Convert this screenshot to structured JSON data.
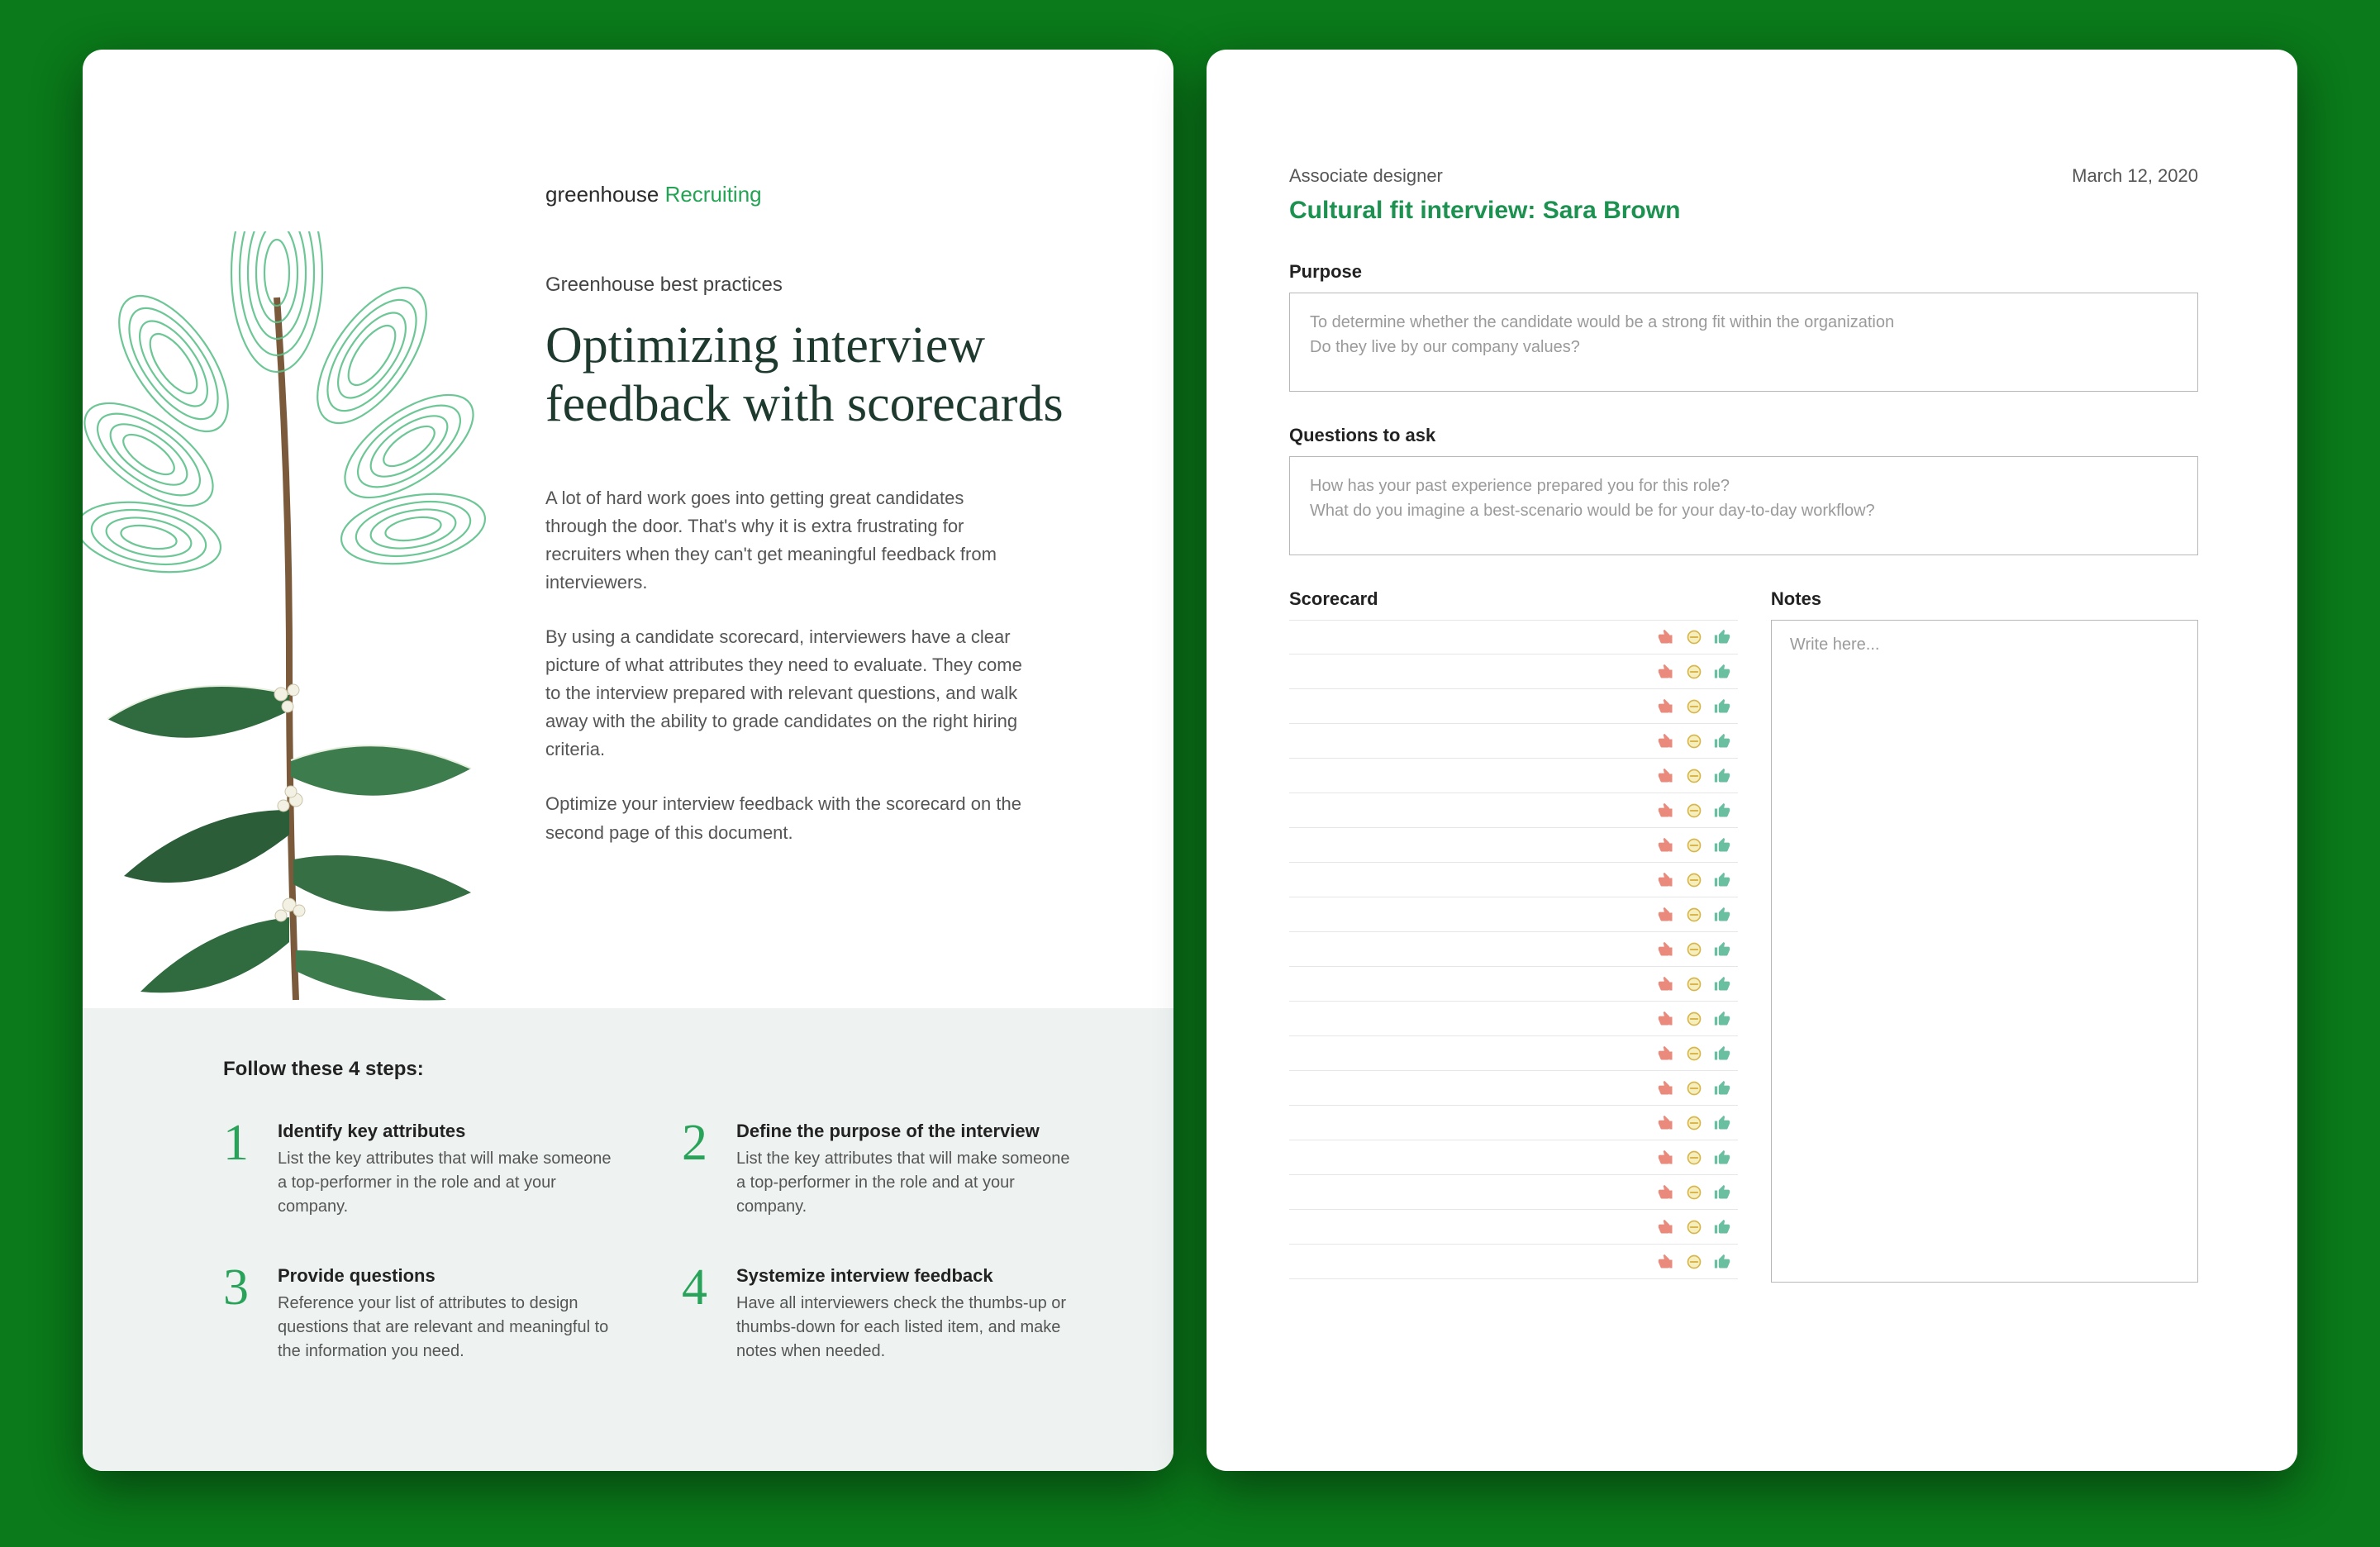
{
  "left": {
    "logo_prefix": "greenhouse ",
    "logo_product": "Recruiting",
    "eyebrow": "Greenhouse best practices",
    "title": "Optimizing interview feedback with scorecards",
    "para1": "A lot of hard work goes into getting great candidates through the door. That's why it is extra frustrating for recruiters when they can't get meaningful feedback from interviewers.",
    "para2": "By using a candidate scorecard, interviewers have a clear picture of what attributes they need to evaluate. They come to the interview prepared with relevant questions, and walk away with the ability to grade candidates on the right hiring criteria.",
    "para3": "Optimize your interview feedback with the scorecard on the second page of this document.",
    "steps_head": "Follow these 4 steps:",
    "steps": [
      {
        "n": "1",
        "title": "Identify key attributes",
        "desc": "List the key attributes that will make someone a top-performer in the role and at your company."
      },
      {
        "n": "2",
        "title": "Define the purpose of the interview",
        "desc": "List the key attributes that will make someone a top-performer in the role and at your company."
      },
      {
        "n": "3",
        "title": "Provide questions",
        "desc": "Reference your list of attributes to design questions that are relevant and meaningful to the information you need."
      },
      {
        "n": "4",
        "title": "Systemize interview feedback",
        "desc": "Have all interviewers check the thumbs-up or thumbs-down for each listed item, and make notes when needed."
      }
    ]
  },
  "right": {
    "role": "Associate designer",
    "date": "March 12, 2020",
    "interview_title": "Cultural fit interview: Sara Brown",
    "purpose_label": "Purpose",
    "purpose_line1": "To determine whether the candidate would be a strong fit within the organization",
    "purpose_line2": "Do they live by our company values?",
    "questions_label": "Questions to ask",
    "questions_line1": "How has your past experience prepared you for this role?",
    "questions_line2": "What do you imagine a best-scenario would be for your day-to-day workflow?",
    "scorecard_label": "Scorecard",
    "notes_label": "Notes",
    "notes_placeholder": "Write here...",
    "scorecard_row_count": 19,
    "colors": {
      "thumb_down": "#e98a7c",
      "neutral_stroke": "#d7b74d",
      "neutral_fill": "#f6eebd",
      "thumb_up": "#6bbfa1"
    }
  }
}
